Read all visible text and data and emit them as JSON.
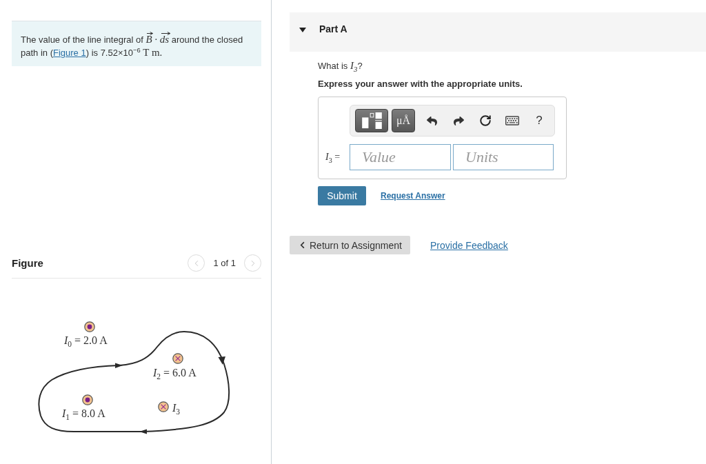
{
  "problem": {
    "segments": [
      {
        "kind": "text",
        "text": "The value of the line integral of "
      },
      {
        "kind": "vector",
        "text": "B"
      },
      {
        "kind": "math",
        "text": " · "
      },
      {
        "kind": "vector",
        "text": "ds"
      },
      {
        "kind": "text",
        "text": " around the closed path in ("
      },
      {
        "kind": "link",
        "text": "Figure 1"
      },
      {
        "kind": "text",
        "text": ") is 7.52×10$^{−6}$ "
      },
      {
        "kind": "unit",
        "text": "T m."
      }
    ]
  },
  "figure": {
    "title": "Figure",
    "pager": {
      "text": "1 of 1",
      "prev_disabled": true,
      "next_disabled": true
    },
    "currents": [
      {
        "kind": "out",
        "label": "*I*$_{0}$ = 2.0 A"
      },
      {
        "kind": "in",
        "label": "*I*$_{2}$ = 6.0 A"
      },
      {
        "kind": "out",
        "label": "*I*$_{1}$ = 8.0 A"
      },
      {
        "kind": "in",
        "label": "*I*$_{3}$"
      }
    ]
  },
  "part": {
    "title": "Part A",
    "expanded": true,
    "question": [
      {
        "kind": "text",
        "text": "What is "
      },
      {
        "kind": "math",
        "text": "I$_{3}$"
      },
      {
        "kind": "text",
        "text": "?"
      }
    ],
    "instruction": "Express your answer with the appropriate units.",
    "toolbar": [
      {
        "kind": "templates"
      },
      {
        "kind": "units",
        "text": "μÅ"
      },
      {
        "kind": "undo"
      },
      {
        "kind": "redo"
      },
      {
        "kind": "reset"
      },
      {
        "kind": "keyboard"
      },
      {
        "kind": "help",
        "text": "?"
      }
    ],
    "answer": {
      "label": "*I*$_{3}$ =",
      "value_placeholder": "Value",
      "units_placeholder": "Units"
    },
    "submit": "Submit",
    "request_answer": "Request Answer"
  },
  "footer": {
    "return_button": "Return to Assignment",
    "feedback_link": "Provide Feedback"
  }
}
